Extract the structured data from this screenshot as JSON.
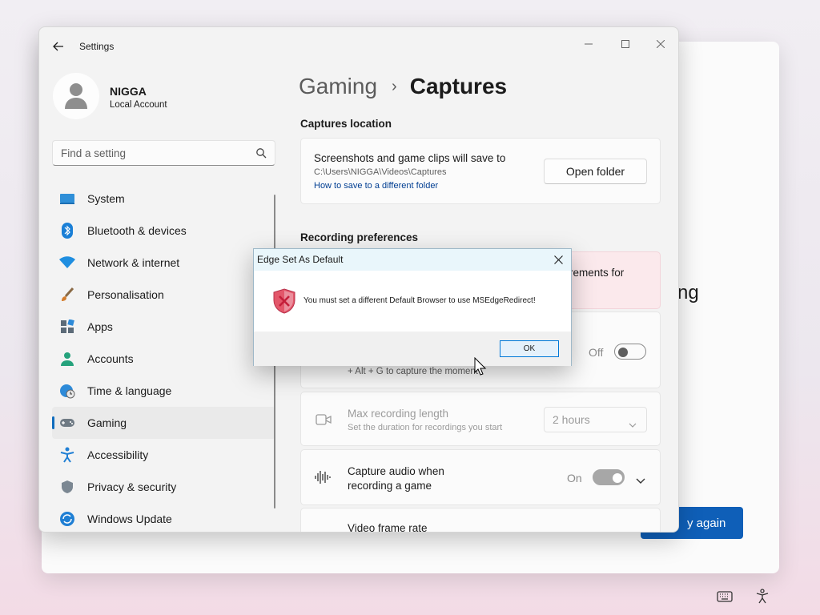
{
  "background": {
    "partial_text": "ng",
    "button_label": "y again"
  },
  "settings": {
    "app_title": "Settings",
    "profile": {
      "name": "NIGGA",
      "account_type": "Local Account"
    },
    "search": {
      "placeholder": "Find a setting"
    },
    "nav": [
      {
        "label": "System",
        "icon": "monitor-icon",
        "active": false
      },
      {
        "label": "Bluetooth & devices",
        "icon": "bluetooth-icon",
        "active": false
      },
      {
        "label": "Network & internet",
        "icon": "wifi-icon",
        "active": false
      },
      {
        "label": "Personalisation",
        "icon": "brush-icon",
        "active": false
      },
      {
        "label": "Apps",
        "icon": "apps-icon",
        "active": false
      },
      {
        "label": "Accounts",
        "icon": "person-icon",
        "active": false
      },
      {
        "label": "Time & language",
        "icon": "globe-clock-icon",
        "active": false
      },
      {
        "label": "Gaming",
        "icon": "gamepad-icon",
        "active": true
      },
      {
        "label": "Accessibility",
        "icon": "accessibility-icon",
        "active": false
      },
      {
        "label": "Privacy & security",
        "icon": "shield-icon",
        "active": false
      },
      {
        "label": "Windows Update",
        "icon": "update-icon",
        "active": false
      }
    ],
    "breadcrumb": {
      "parent": "Gaming",
      "separator": "›",
      "current": "Captures"
    },
    "captures_location": {
      "heading": "Captures location",
      "title": "Screenshots and game clips will save to",
      "path": "C:\\Users\\NIGGA\\Videos\\Captures",
      "link": "How to save to a different folder",
      "button": "Open folder"
    },
    "recording_preferences": {
      "heading": "Recording preferences",
      "warning_partial": "rements for",
      "record_what_happened": {
        "toggle_label": "Off",
        "subtitle_partial": "+ Alt + G to capture the moment"
      },
      "max_length": {
        "title": "Max recording length",
        "subtitle": "Set the duration for recordings you start",
        "value": "2 hours"
      },
      "capture_audio": {
        "title_line1": "Capture audio when",
        "title_line2": "recording a game",
        "toggle_label": "On"
      },
      "frame_rate": {
        "title": "Video frame rate"
      }
    }
  },
  "dialog": {
    "title": "Edge Set As Default",
    "message": "You must set a different Default Browser to use MSEdgeRedirect!",
    "ok_label": "OK"
  }
}
